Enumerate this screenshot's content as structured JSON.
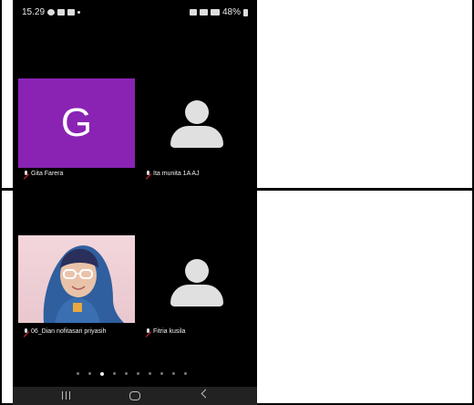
{
  "status_bar": {
    "time": "15.29",
    "battery": "48%"
  },
  "participants": [
    {
      "initial": "G",
      "name": "Gita Farera",
      "avatar_color": "#8a23b4"
    },
    {
      "initial": "",
      "name": "Ita munita 1A AJ"
    },
    {
      "initial": "",
      "name": "06_Dian nofitasari priyasih"
    },
    {
      "initial": "",
      "name": "Fitria kusila"
    }
  ],
  "pagination": {
    "total": 10,
    "active": 3
  },
  "icons": {
    "mic_muted": "mic-muted-icon",
    "person": "person-placeholder-icon"
  }
}
